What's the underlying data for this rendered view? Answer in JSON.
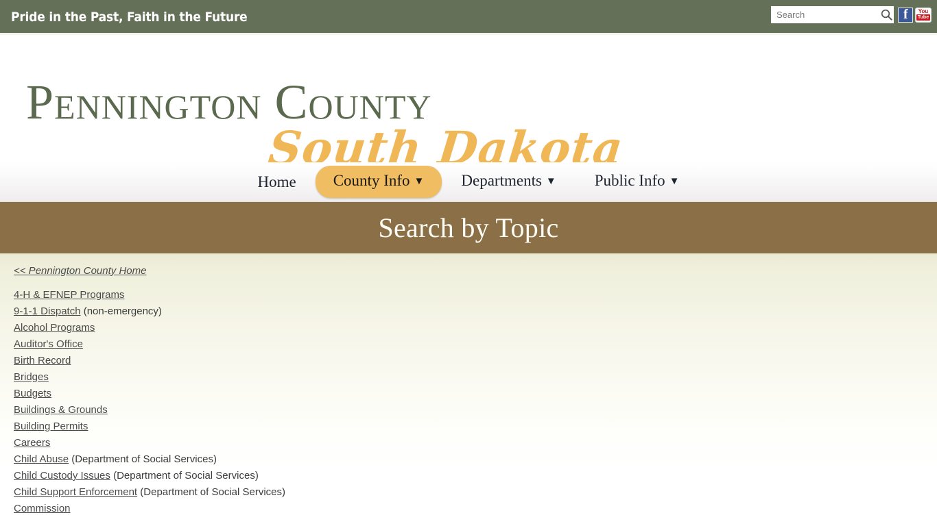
{
  "topbar": {
    "tagline": "Pride in the Past, Faith in the Future",
    "search_placeholder": "Search",
    "search_value": "",
    "search_button_label": "Search",
    "facebook_label": "Facebook",
    "youtube_top": "You",
    "youtube_bottom": "Tube",
    "bar_color": "#647057"
  },
  "logo": {
    "line1": "Pennington County",
    "line2": "South Dakota",
    "line1_color": "#5b6a4e",
    "line2_color": "#f0b757"
  },
  "nav": {
    "items": [
      {
        "label": "Home",
        "caret": "",
        "active": false
      },
      {
        "label": "County Info",
        "caret": "▼",
        "active": true
      },
      {
        "label": "Departments",
        "caret": "▼",
        "active": false
      },
      {
        "label": "Public Info",
        "caret": "▼",
        "active": false
      }
    ],
    "active_color": "#f0bd62"
  },
  "banner": {
    "title": "Search by Topic",
    "background": "#8b7047"
  },
  "content": {
    "home_link": "<< Pennington County Home",
    "topics": [
      {
        "link": "4-H & EFNEP Programs",
        "note": ""
      },
      {
        "link": "9-1-1 Dispatch",
        "note": " (non-emergency)"
      },
      {
        "link": "Alcohol Programs",
        "note": ""
      },
      {
        "link": "Auditor's Office",
        "note": ""
      },
      {
        "link": "Birth Record",
        "note": ""
      },
      {
        "link": "Bridges",
        "note": ""
      },
      {
        "link": "Budgets",
        "note": ""
      },
      {
        "link": "Buildings & Grounds",
        "note": ""
      },
      {
        "link": "Building Permits",
        "note": ""
      },
      {
        "link": "Careers",
        "note": ""
      },
      {
        "link": "Child Abuse",
        "note": " (Department of Social Services)"
      },
      {
        "link": "Child Custody Issues",
        "note": " (Department of Social Services)"
      },
      {
        "link": "Child Support Enforcement",
        "note": " (Department of Social Services)"
      },
      {
        "link": "Commission",
        "note": ""
      }
    ]
  }
}
